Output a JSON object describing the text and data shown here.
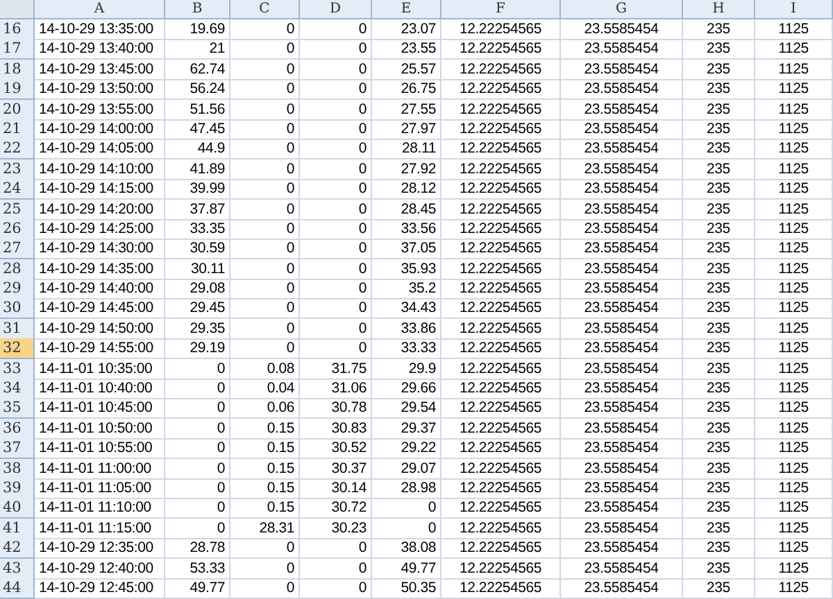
{
  "columns": [
    "A",
    "B",
    "C",
    "D",
    "E",
    "F",
    "G",
    "H",
    "I"
  ],
  "rows": [
    {
      "number": "16",
      "selected": false,
      "cells": [
        "14-10-29 13:35:00",
        "19.69",
        "0",
        "0",
        "23.07",
        "12.22254565",
        "23.5585454",
        "235",
        "1125"
      ]
    },
    {
      "number": "17",
      "selected": false,
      "cells": [
        "14-10-29 13:40:00",
        "21",
        "0",
        "0",
        "23.55",
        "12.22254565",
        "23.5585454",
        "235",
        "1125"
      ]
    },
    {
      "number": "18",
      "selected": false,
      "cells": [
        "14-10-29 13:45:00",
        "62.74",
        "0",
        "0",
        "25.57",
        "12.22254565",
        "23.5585454",
        "235",
        "1125"
      ]
    },
    {
      "number": "19",
      "selected": false,
      "cells": [
        "14-10-29 13:50:00",
        "56.24",
        "0",
        "0",
        "26.75",
        "12.22254565",
        "23.5585454",
        "235",
        "1125"
      ]
    },
    {
      "number": "20",
      "selected": false,
      "cells": [
        "14-10-29 13:55:00",
        "51.56",
        "0",
        "0",
        "27.55",
        "12.22254565",
        "23.5585454",
        "235",
        "1125"
      ]
    },
    {
      "number": "21",
      "selected": false,
      "cells": [
        "14-10-29 14:00:00",
        "47.45",
        "0",
        "0",
        "27.97",
        "12.22254565",
        "23.5585454",
        "235",
        "1125"
      ]
    },
    {
      "number": "22",
      "selected": false,
      "cells": [
        "14-10-29 14:05:00",
        "44.9",
        "0",
        "0",
        "28.11",
        "12.22254565",
        "23.5585454",
        "235",
        "1125"
      ]
    },
    {
      "number": "23",
      "selected": false,
      "cells": [
        "14-10-29 14:10:00",
        "41.89",
        "0",
        "0",
        "27.92",
        "12.22254565",
        "23.5585454",
        "235",
        "1125"
      ]
    },
    {
      "number": "24",
      "selected": false,
      "cells": [
        "14-10-29 14:15:00",
        "39.99",
        "0",
        "0",
        "28.12",
        "12.22254565",
        "23.5585454",
        "235",
        "1125"
      ]
    },
    {
      "number": "25",
      "selected": false,
      "cells": [
        "14-10-29 14:20:00",
        "37.87",
        "0",
        "0",
        "28.45",
        "12.22254565",
        "23.5585454",
        "235",
        "1125"
      ]
    },
    {
      "number": "26",
      "selected": false,
      "cells": [
        "14-10-29 14:25:00",
        "33.35",
        "0",
        "0",
        "33.56",
        "12.22254565",
        "23.5585454",
        "235",
        "1125"
      ]
    },
    {
      "number": "27",
      "selected": false,
      "cells": [
        "14-10-29 14:30:00",
        "30.59",
        "0",
        "0",
        "37.05",
        "12.22254565",
        "23.5585454",
        "235",
        "1125"
      ]
    },
    {
      "number": "28",
      "selected": false,
      "cells": [
        "14-10-29 14:35:00",
        "30.11",
        "0",
        "0",
        "35.93",
        "12.22254565",
        "23.5585454",
        "235",
        "1125"
      ]
    },
    {
      "number": "29",
      "selected": false,
      "cells": [
        "14-10-29 14:40:00",
        "29.08",
        "0",
        "0",
        "35.2",
        "12.22254565",
        "23.5585454",
        "235",
        "1125"
      ]
    },
    {
      "number": "30",
      "selected": false,
      "cells": [
        "14-10-29 14:45:00",
        "29.45",
        "0",
        "0",
        "34.43",
        "12.22254565",
        "23.5585454",
        "235",
        "1125"
      ]
    },
    {
      "number": "31",
      "selected": false,
      "cells": [
        "14-10-29 14:50:00",
        "29.35",
        "0",
        "0",
        "33.86",
        "12.22254565",
        "23.5585454",
        "235",
        "1125"
      ]
    },
    {
      "number": "32",
      "selected": true,
      "cells": [
        "14-10-29 14:55:00",
        "29.19",
        "0",
        "0",
        "33.33",
        "12.22254565",
        "23.5585454",
        "235",
        "1125"
      ]
    },
    {
      "number": "33",
      "selected": false,
      "cells": [
        "14-11-01 10:35:00",
        "0",
        "0.08",
        "31.75",
        "29.9",
        "12.22254565",
        "23.5585454",
        "235",
        "1125"
      ]
    },
    {
      "number": "34",
      "selected": false,
      "cells": [
        "14-11-01 10:40:00",
        "0",
        "0.04",
        "31.06",
        "29.66",
        "12.22254565",
        "23.5585454",
        "235",
        "1125"
      ]
    },
    {
      "number": "35",
      "selected": false,
      "cells": [
        "14-11-01 10:45:00",
        "0",
        "0.06",
        "30.78",
        "29.54",
        "12.22254565",
        "23.5585454",
        "235",
        "1125"
      ]
    },
    {
      "number": "36",
      "selected": false,
      "cells": [
        "14-11-01 10:50:00",
        "0",
        "0.15",
        "30.83",
        "29.37",
        "12.22254565",
        "23.5585454",
        "235",
        "1125"
      ]
    },
    {
      "number": "37",
      "selected": false,
      "cells": [
        "14-11-01 10:55:00",
        "0",
        "0.15",
        "30.52",
        "29.22",
        "12.22254565",
        "23.5585454",
        "235",
        "1125"
      ]
    },
    {
      "number": "38",
      "selected": false,
      "cells": [
        "14-11-01 11:00:00",
        "0",
        "0.15",
        "30.37",
        "29.07",
        "12.22254565",
        "23.5585454",
        "235",
        "1125"
      ]
    },
    {
      "number": "39",
      "selected": false,
      "cells": [
        "14-11-01 11:05:00",
        "0",
        "0.15",
        "30.14",
        "28.98",
        "12.22254565",
        "23.5585454",
        "235",
        "1125"
      ]
    },
    {
      "number": "40",
      "selected": false,
      "cells": [
        "14-11-01 11:10:00",
        "0",
        "0.15",
        "30.72",
        "0",
        "12.22254565",
        "23.5585454",
        "235",
        "1125"
      ]
    },
    {
      "number": "41",
      "selected": false,
      "cells": [
        "14-11-01 11:15:00",
        "0",
        "28.31",
        "30.23",
        "0",
        "12.22254565",
        "23.5585454",
        "235",
        "1125"
      ]
    },
    {
      "number": "42",
      "selected": false,
      "cells": [
        "14-10-29 12:35:00",
        "28.78",
        "0",
        "0",
        "38.08",
        "12.22254565",
        "23.5585454",
        "235",
        "1125"
      ]
    },
    {
      "number": "43",
      "selected": false,
      "cells": [
        "14-10-29 12:40:00",
        "53.33",
        "0",
        "0",
        "49.77",
        "12.22254565",
        "23.5585454",
        "235",
        "1125"
      ]
    },
    {
      "number": "44",
      "selected": false,
      "cells": [
        "14-10-29 12:45:00",
        "49.77",
        "0",
        "0",
        "50.35",
        "12.22254565",
        "23.5585454",
        "235",
        "1125"
      ]
    }
  ]
}
